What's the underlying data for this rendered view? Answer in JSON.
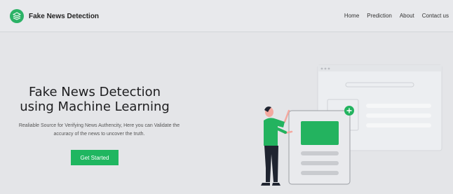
{
  "navbar": {
    "brand": "Fake News Detection",
    "links": [
      "Home",
      "Prediction",
      "About",
      "Contact us"
    ]
  },
  "hero": {
    "title_line1": "Fake News Detection",
    "title_line2": "using Machine Learning",
    "description_line1": "Realiable Source for Verifying News Authencity, Here you can Validate the",
    "description_line2": "accuracy of the news to uncover the truth.",
    "cta_label": "Get Started"
  },
  "colors": {
    "accent": "#2bb266",
    "button": "#1fb660",
    "background": "#e4e5e8"
  },
  "icons": {
    "brand": "layers-icon",
    "plus": "plus-icon"
  }
}
